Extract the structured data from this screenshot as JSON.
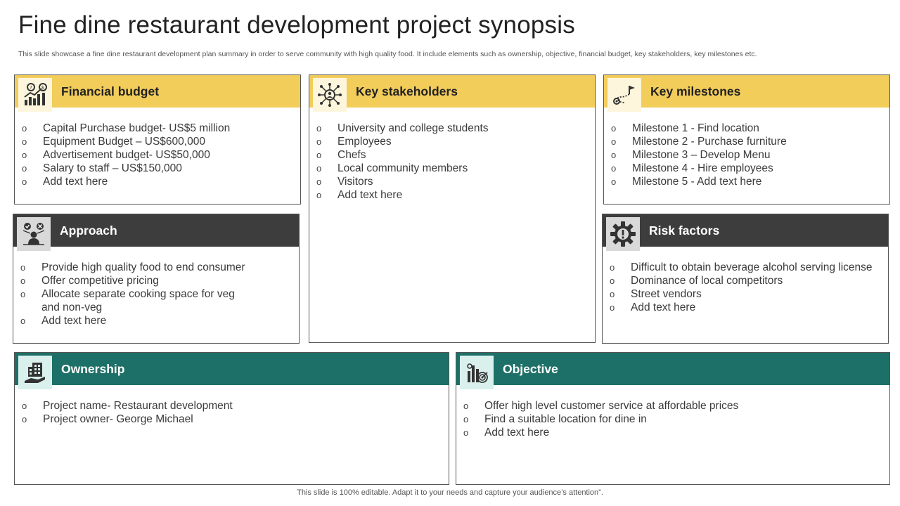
{
  "title": "Fine dine restaurant development project synopsis",
  "subtitle": "This slide showcase a fine dine restaurant development plan summary in order to  serve community with high quality food. It include elements such as ownership, objective, financial budget, key stakeholders, key milestones etc.",
  "footer": "This slide is 100% editable. Adapt it to your needs and capture your audience’s attention”.",
  "colors": {
    "yellow": "#f3cd5a",
    "dark": "#3d3d3d",
    "teal": "#1d7067"
  },
  "cards": {
    "financial_budget": {
      "title": "Financial budget",
      "icon": "budget-chart-icon",
      "items": [
        "Capital Purchase budget- US$5 million",
        "Equipment Budget – US$600,000",
        "Advertisement budget- US$50,000",
        "Salary to staff – US$150,000",
        "Add text here"
      ]
    },
    "key_stakeholders": {
      "title": "Key stakeholders",
      "icon": "network-people-icon",
      "items": [
        "University and college students",
        "Employees",
        "Chefs",
        "Local community  members",
        "Visitors",
        "Add text here"
      ]
    },
    "key_milestones": {
      "title": "Key milestones",
      "icon": "route-flag-icon",
      "items": [
        "Milestone 1 - Find location",
        "Milestone 2 - Purchase furniture",
        "Milestone 3 – Develop Menu",
        "Milestone 4 - Hire employees",
        "Milestone 5 - Add text here"
      ]
    },
    "approach": {
      "title": "Approach",
      "icon": "decision-person-icon",
      "items": [
        "Provide high quality food to end consumer",
        "Offer competitive pricing",
        "Allocate separate cooking space for veg and non-veg",
        "Add text here"
      ]
    },
    "risk_factors": {
      "title": "Risk factors",
      "icon": "gear-alert-icon",
      "items": [
        "Difficult to obtain beverage alcohol serving license",
        "Dominance of local competitors",
        "Street vendors",
        "Add text here"
      ]
    },
    "ownership": {
      "title": "Ownership",
      "icon": "building-hand-icon",
      "items": [
        "Project name- Restaurant development",
        "Project owner- George Michael"
      ]
    },
    "objective": {
      "title": "Objective",
      "icon": "target-chart-icon",
      "items": [
        "Offer high level customer service at affordable prices",
        "Find a suitable location for dine in",
        "Add text here"
      ]
    }
  }
}
